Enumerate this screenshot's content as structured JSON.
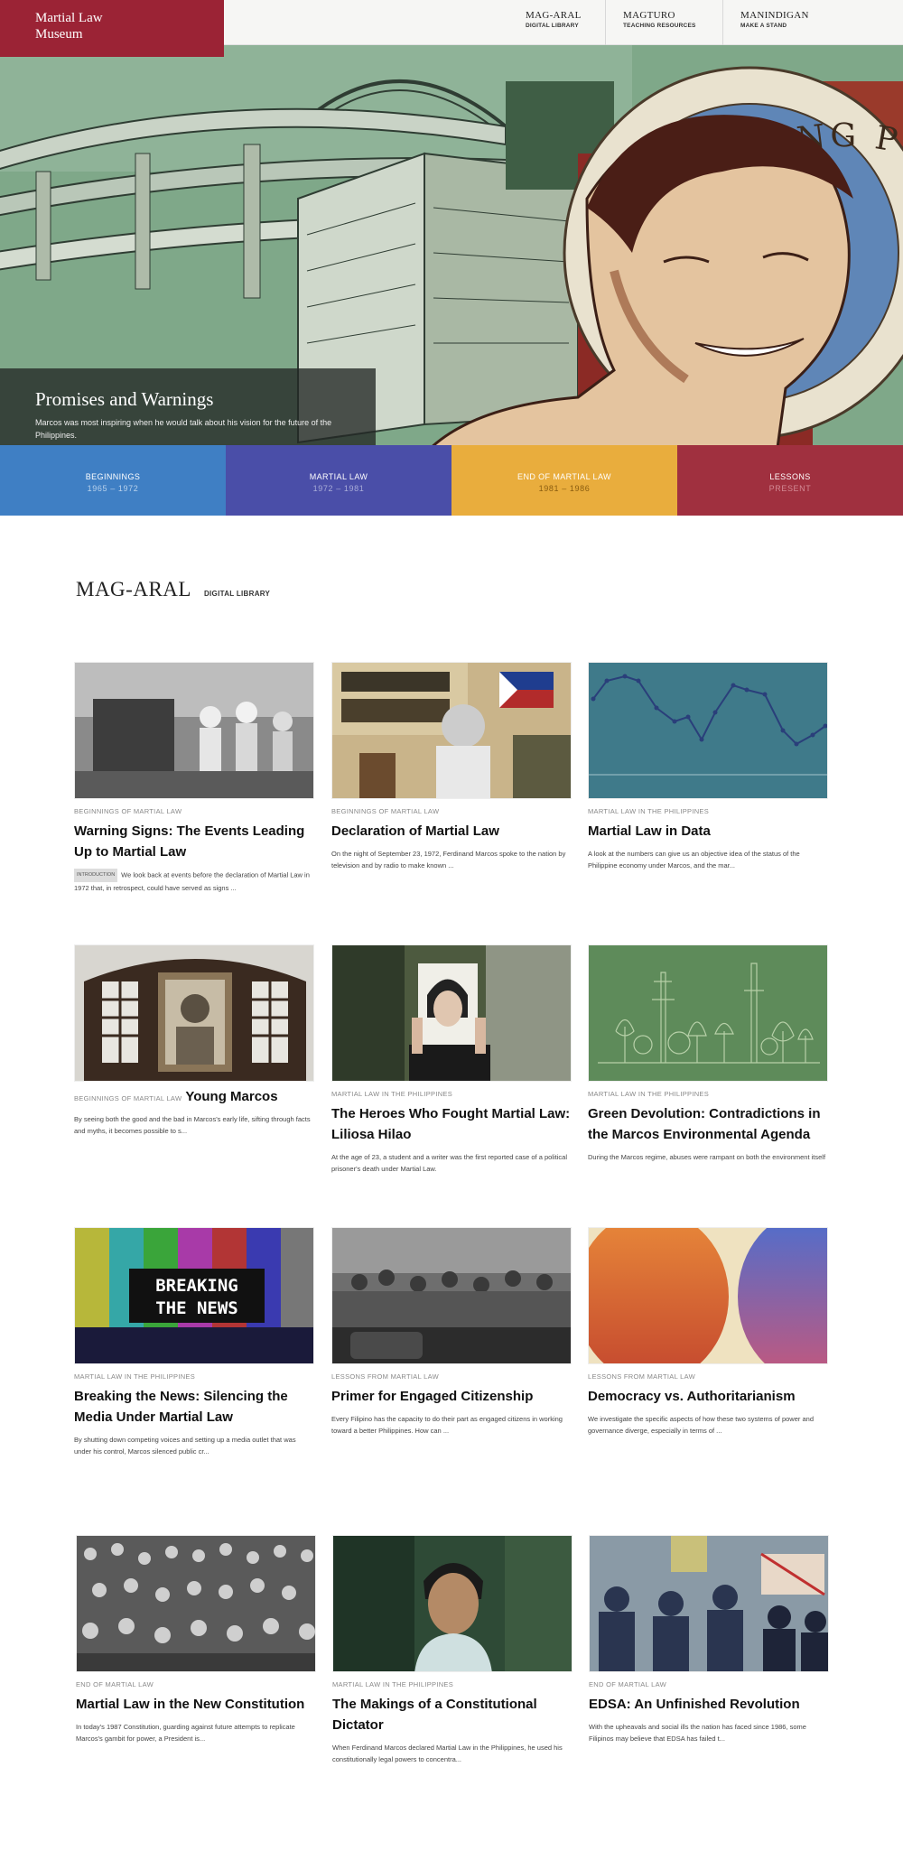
{
  "brand": {
    "line1": "Martial Law",
    "line2": "Museum"
  },
  "nav": [
    {
      "title": "MAG-ARAL",
      "sub": "DIGITAL LIBRARY"
    },
    {
      "title": "MAGTURO",
      "sub": "TEACHING RESOURCES"
    },
    {
      "title": "MANINDIGAN",
      "sub": "MAKE A STAND"
    }
  ],
  "hero": {
    "title": "Promises and Warnings",
    "description": "Marcos was most inspiring when he would talk about his vision for the future of the Philippines.",
    "seal_text": "PANGULO NG PILIPINAS"
  },
  "eras": [
    {
      "name": "BEGINNINGS",
      "years": "1965 – 1972",
      "color": "#3f7fc4"
    },
    {
      "name": "MARTIAL LAW",
      "years": "1972 – 1981",
      "color": "#4a4ea8"
    },
    {
      "name": "END OF MARTIAL LAW",
      "years": "1981 – 1986",
      "color": "#e9ad3d"
    },
    {
      "name": "LESSONS",
      "years": "PRESENT",
      "color": "#a0303f"
    }
  ],
  "library": {
    "title": "MAG-ARAL",
    "subtitle": "DIGITAL LIBRARY"
  },
  "cards": [
    {
      "category": "BEGINNINGS OF MARTIAL LAW",
      "title": "Warning Signs: The Events Leading Up to Martial Law",
      "tag": "INTRODUCTION",
      "desc": "We look back at events before the declaration of Martial Law in 1972 that, in retrospect, could have served as signs ..."
    },
    {
      "category": "BEGINNINGS OF MARTIAL LAW",
      "title": "Declaration of Martial Law",
      "desc": "On the night of September 23, 1972, Ferdinand Marcos spoke to the nation by television and by radio to make known ..."
    },
    {
      "category": "MARTIAL LAW IN THE PHILIPPINES",
      "title": "Martial Law in Data",
      "desc": "A look at the numbers can give us an objective idea of the status of the Philippine economy under Marcos, and the mar..."
    },
    {
      "category": "BEGINNINGS OF MARTIAL LAW",
      "title": "Young Marcos",
      "desc": "By seeing both the good and the bad in Marcos's early life, sifting through facts and myths, it becomes possible to s..."
    },
    {
      "category": "MARTIAL LAW IN THE PHILIPPINES",
      "title": "The Heroes Who Fought Martial Law: Liliosa Hilao",
      "desc": "At the age of 23, a student and a writer was the first reported case of a political prisoner's death under Martial Law."
    },
    {
      "category": "MARTIAL LAW IN THE PHILIPPINES",
      "title": "Green Devolution: Contradictions in the Marcos Environmental Agenda",
      "desc": "During the Marcos regime, abuses were rampant on both the environment itself and the indigenous peoples who depended ..."
    },
    {
      "category": "MARTIAL LAW IN THE PHILIPPINES",
      "title": "Breaking the News: Silencing the Media Under Martial Law",
      "desc": "By shutting down competing voices and setting up a media outlet that was under his control, Marcos silenced public cr...",
      "thumb_text": [
        "BREAKING",
        "THE NEWS"
      ]
    },
    {
      "category": "LESSONS FROM MARTIAL LAW",
      "title": "Primer for Engaged Citizenship",
      "desc": "Every Filipino has the capacity to do their part as engaged citizens in working toward a better Philippines. How can ..."
    },
    {
      "category": "LESSONS FROM MARTIAL LAW",
      "title": "Democracy vs. Authoritarianism",
      "desc": "We investigate the specific aspects of how these two systems of power and governance diverge, especially in terms of ..."
    },
    {
      "category": "END OF MARTIAL LAW",
      "title": "Martial Law in the New Constitution",
      "desc": "In today's 1987 Constitution, guarding against future attempts to replicate Marcos's gambit for power, a President is..."
    },
    {
      "category": "MARTIAL LAW IN THE PHILIPPINES",
      "title": "The Makings of a Constitutional Dictator",
      "desc": "When Ferdinand Marcos declared Martial Law in the Philippines, he used his constitutionally legal powers to concentra..."
    },
    {
      "category": "END OF MARTIAL LAW",
      "title": "EDSA: An Unfinished Revolution",
      "desc": "With the upheavals and social ills the nation has faced since 1986, some Filipinos may believe that EDSA has failed t..."
    }
  ]
}
